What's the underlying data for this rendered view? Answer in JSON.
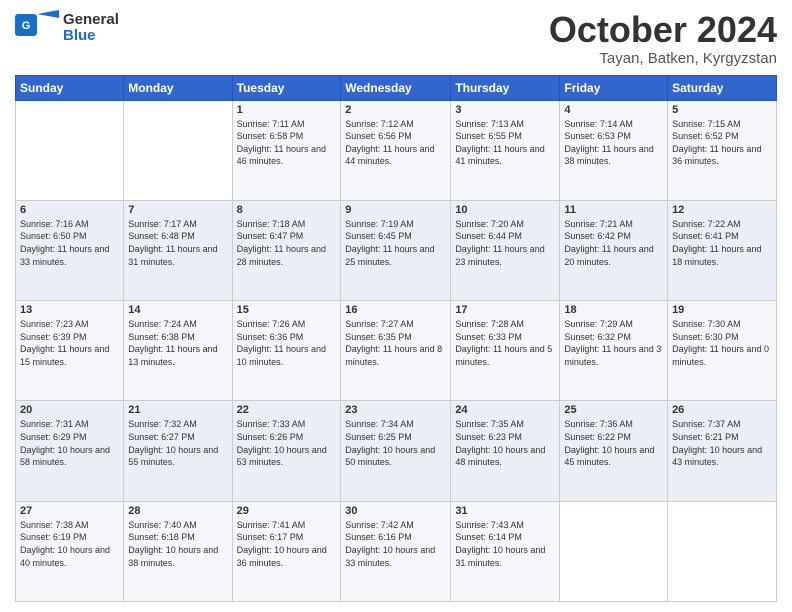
{
  "logo": {
    "line1": "General",
    "line2": "Blue"
  },
  "header": {
    "month": "October 2024",
    "location": "Tayan, Batken, Kyrgyzstan"
  },
  "days_of_week": [
    "Sunday",
    "Monday",
    "Tuesday",
    "Wednesday",
    "Thursday",
    "Friday",
    "Saturday"
  ],
  "weeks": [
    [
      {
        "day": "",
        "sunrise": "",
        "sunset": "",
        "daylight": ""
      },
      {
        "day": "",
        "sunrise": "",
        "sunset": "",
        "daylight": ""
      },
      {
        "day": "1",
        "sunrise": "Sunrise: 7:11 AM",
        "sunset": "Sunset: 6:58 PM",
        "daylight": "Daylight: 11 hours and 46 minutes."
      },
      {
        "day": "2",
        "sunrise": "Sunrise: 7:12 AM",
        "sunset": "Sunset: 6:56 PM",
        "daylight": "Daylight: 11 hours and 44 minutes."
      },
      {
        "day": "3",
        "sunrise": "Sunrise: 7:13 AM",
        "sunset": "Sunset: 6:55 PM",
        "daylight": "Daylight: 11 hours and 41 minutes."
      },
      {
        "day": "4",
        "sunrise": "Sunrise: 7:14 AM",
        "sunset": "Sunset: 6:53 PM",
        "daylight": "Daylight: 11 hours and 38 minutes."
      },
      {
        "day": "5",
        "sunrise": "Sunrise: 7:15 AM",
        "sunset": "Sunset: 6:52 PM",
        "daylight": "Daylight: 11 hours and 36 minutes."
      }
    ],
    [
      {
        "day": "6",
        "sunrise": "Sunrise: 7:16 AM",
        "sunset": "Sunset: 6:50 PM",
        "daylight": "Daylight: 11 hours and 33 minutes."
      },
      {
        "day": "7",
        "sunrise": "Sunrise: 7:17 AM",
        "sunset": "Sunset: 6:48 PM",
        "daylight": "Daylight: 11 hours and 31 minutes."
      },
      {
        "day": "8",
        "sunrise": "Sunrise: 7:18 AM",
        "sunset": "Sunset: 6:47 PM",
        "daylight": "Daylight: 11 hours and 28 minutes."
      },
      {
        "day": "9",
        "sunrise": "Sunrise: 7:19 AM",
        "sunset": "Sunset: 6:45 PM",
        "daylight": "Daylight: 11 hours and 25 minutes."
      },
      {
        "day": "10",
        "sunrise": "Sunrise: 7:20 AM",
        "sunset": "Sunset: 6:44 PM",
        "daylight": "Daylight: 11 hours and 23 minutes."
      },
      {
        "day": "11",
        "sunrise": "Sunrise: 7:21 AM",
        "sunset": "Sunset: 6:42 PM",
        "daylight": "Daylight: 11 hours and 20 minutes."
      },
      {
        "day": "12",
        "sunrise": "Sunrise: 7:22 AM",
        "sunset": "Sunset: 6:41 PM",
        "daylight": "Daylight: 11 hours and 18 minutes."
      }
    ],
    [
      {
        "day": "13",
        "sunrise": "Sunrise: 7:23 AM",
        "sunset": "Sunset: 6:39 PM",
        "daylight": "Daylight: 11 hours and 15 minutes."
      },
      {
        "day": "14",
        "sunrise": "Sunrise: 7:24 AM",
        "sunset": "Sunset: 6:38 PM",
        "daylight": "Daylight: 11 hours and 13 minutes."
      },
      {
        "day": "15",
        "sunrise": "Sunrise: 7:26 AM",
        "sunset": "Sunset: 6:36 PM",
        "daylight": "Daylight: 11 hours and 10 minutes."
      },
      {
        "day": "16",
        "sunrise": "Sunrise: 7:27 AM",
        "sunset": "Sunset: 6:35 PM",
        "daylight": "Daylight: 11 hours and 8 minutes."
      },
      {
        "day": "17",
        "sunrise": "Sunrise: 7:28 AM",
        "sunset": "Sunset: 6:33 PM",
        "daylight": "Daylight: 11 hours and 5 minutes."
      },
      {
        "day": "18",
        "sunrise": "Sunrise: 7:29 AM",
        "sunset": "Sunset: 6:32 PM",
        "daylight": "Daylight: 11 hours and 3 minutes."
      },
      {
        "day": "19",
        "sunrise": "Sunrise: 7:30 AM",
        "sunset": "Sunset: 6:30 PM",
        "daylight": "Daylight: 11 hours and 0 minutes."
      }
    ],
    [
      {
        "day": "20",
        "sunrise": "Sunrise: 7:31 AM",
        "sunset": "Sunset: 6:29 PM",
        "daylight": "Daylight: 10 hours and 58 minutes."
      },
      {
        "day": "21",
        "sunrise": "Sunrise: 7:32 AM",
        "sunset": "Sunset: 6:27 PM",
        "daylight": "Daylight: 10 hours and 55 minutes."
      },
      {
        "day": "22",
        "sunrise": "Sunrise: 7:33 AM",
        "sunset": "Sunset: 6:26 PM",
        "daylight": "Daylight: 10 hours and 53 minutes."
      },
      {
        "day": "23",
        "sunrise": "Sunrise: 7:34 AM",
        "sunset": "Sunset: 6:25 PM",
        "daylight": "Daylight: 10 hours and 50 minutes."
      },
      {
        "day": "24",
        "sunrise": "Sunrise: 7:35 AM",
        "sunset": "Sunset: 6:23 PM",
        "daylight": "Daylight: 10 hours and 48 minutes."
      },
      {
        "day": "25",
        "sunrise": "Sunrise: 7:36 AM",
        "sunset": "Sunset: 6:22 PM",
        "daylight": "Daylight: 10 hours and 45 minutes."
      },
      {
        "day": "26",
        "sunrise": "Sunrise: 7:37 AM",
        "sunset": "Sunset: 6:21 PM",
        "daylight": "Daylight: 10 hours and 43 minutes."
      }
    ],
    [
      {
        "day": "27",
        "sunrise": "Sunrise: 7:38 AM",
        "sunset": "Sunset: 6:19 PM",
        "daylight": "Daylight: 10 hours and 40 minutes."
      },
      {
        "day": "28",
        "sunrise": "Sunrise: 7:40 AM",
        "sunset": "Sunset: 6:18 PM",
        "daylight": "Daylight: 10 hours and 38 minutes."
      },
      {
        "day": "29",
        "sunrise": "Sunrise: 7:41 AM",
        "sunset": "Sunset: 6:17 PM",
        "daylight": "Daylight: 10 hours and 36 minutes."
      },
      {
        "day": "30",
        "sunrise": "Sunrise: 7:42 AM",
        "sunset": "Sunset: 6:16 PM",
        "daylight": "Daylight: 10 hours and 33 minutes."
      },
      {
        "day": "31",
        "sunrise": "Sunrise: 7:43 AM",
        "sunset": "Sunset: 6:14 PM",
        "daylight": "Daylight: 10 hours and 31 minutes."
      },
      {
        "day": "",
        "sunrise": "",
        "sunset": "",
        "daylight": ""
      },
      {
        "day": "",
        "sunrise": "",
        "sunset": "",
        "daylight": ""
      }
    ]
  ]
}
